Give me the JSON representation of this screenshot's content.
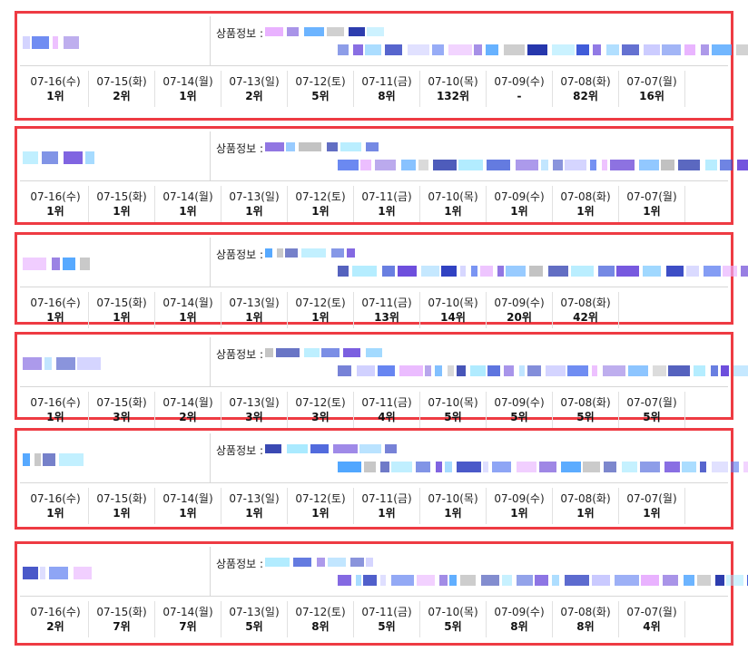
{
  "label_info": "상품정보 :",
  "colors": {
    "card_border": "#ee3b43",
    "divider": "#d7d7d7"
  },
  "cards": [
    {
      "days": [
        {
          "date": "07-16(수)",
          "rank": "1위"
        },
        {
          "date": "07-15(화)",
          "rank": "2위"
        },
        {
          "date": "07-14(월)",
          "rank": "1위"
        },
        {
          "date": "07-13(일)",
          "rank": "2위"
        },
        {
          "date": "07-12(토)",
          "rank": "5위"
        },
        {
          "date": "07-11(금)",
          "rank": "8위"
        },
        {
          "date": "07-10(목)",
          "rank": "132위"
        },
        {
          "date": "07-09(수)",
          "rank": "-"
        },
        {
          "date": "07-08(화)",
          "rank": "82위"
        },
        {
          "date": "07-07(월)",
          "rank": "16위"
        }
      ]
    },
    {
      "days": [
        {
          "date": "07-16(수)",
          "rank": "1위"
        },
        {
          "date": "07-15(화)",
          "rank": "1위"
        },
        {
          "date": "07-14(월)",
          "rank": "1위"
        },
        {
          "date": "07-13(일)",
          "rank": "1위"
        },
        {
          "date": "07-12(토)",
          "rank": "1위"
        },
        {
          "date": "07-11(금)",
          "rank": "1위"
        },
        {
          "date": "07-10(목)",
          "rank": "1위"
        },
        {
          "date": "07-09(수)",
          "rank": "1위"
        },
        {
          "date": "07-08(화)",
          "rank": "1위"
        },
        {
          "date": "07-07(월)",
          "rank": "1위"
        }
      ]
    },
    {
      "days": [
        {
          "date": "07-16(수)",
          "rank": "1위"
        },
        {
          "date": "07-15(화)",
          "rank": "1위"
        },
        {
          "date": "07-14(월)",
          "rank": "1위"
        },
        {
          "date": "07-13(일)",
          "rank": "1위"
        },
        {
          "date": "07-12(토)",
          "rank": "1위"
        },
        {
          "date": "07-11(금)",
          "rank": "13위"
        },
        {
          "date": "07-10(목)",
          "rank": "14위"
        },
        {
          "date": "07-09(수)",
          "rank": "20위"
        },
        {
          "date": "07-08(화)",
          "rank": "42위"
        }
      ]
    },
    {
      "days": [
        {
          "date": "07-16(수)",
          "rank": "1위"
        },
        {
          "date": "07-15(화)",
          "rank": "3위"
        },
        {
          "date": "07-14(월)",
          "rank": "2위"
        },
        {
          "date": "07-13(일)",
          "rank": "3위"
        },
        {
          "date": "07-12(토)",
          "rank": "3위"
        },
        {
          "date": "07-11(금)",
          "rank": "4위"
        },
        {
          "date": "07-10(목)",
          "rank": "5위"
        },
        {
          "date": "07-09(수)",
          "rank": "5위"
        },
        {
          "date": "07-08(화)",
          "rank": "5위"
        },
        {
          "date": "07-07(월)",
          "rank": "5위"
        }
      ]
    },
    {
      "days": [
        {
          "date": "07-16(수)",
          "rank": "1위"
        },
        {
          "date": "07-15(화)",
          "rank": "1위"
        },
        {
          "date": "07-14(월)",
          "rank": "1위"
        },
        {
          "date": "07-13(일)",
          "rank": "1위"
        },
        {
          "date": "07-12(토)",
          "rank": "1위"
        },
        {
          "date": "07-11(금)",
          "rank": "1위"
        },
        {
          "date": "07-10(목)",
          "rank": "1위"
        },
        {
          "date": "07-09(수)",
          "rank": "1위"
        },
        {
          "date": "07-08(화)",
          "rank": "1위"
        },
        {
          "date": "07-07(월)",
          "rank": "1위"
        }
      ]
    },
    {
      "days": [
        {
          "date": "07-16(수)",
          "rank": "2위"
        },
        {
          "date": "07-15(화)",
          "rank": "7위"
        },
        {
          "date": "07-14(월)",
          "rank": "7위"
        },
        {
          "date": "07-13(일)",
          "rank": "5위"
        },
        {
          "date": "07-12(토)",
          "rank": "8위"
        },
        {
          "date": "07-11(금)",
          "rank": "5위"
        },
        {
          "date": "07-10(목)",
          "rank": "5위"
        },
        {
          "date": "07-09(수)",
          "rank": "8위"
        },
        {
          "date": "07-08(화)",
          "rank": "8위"
        },
        {
          "date": "07-07(월)",
          "rank": "4위"
        }
      ]
    }
  ]
}
